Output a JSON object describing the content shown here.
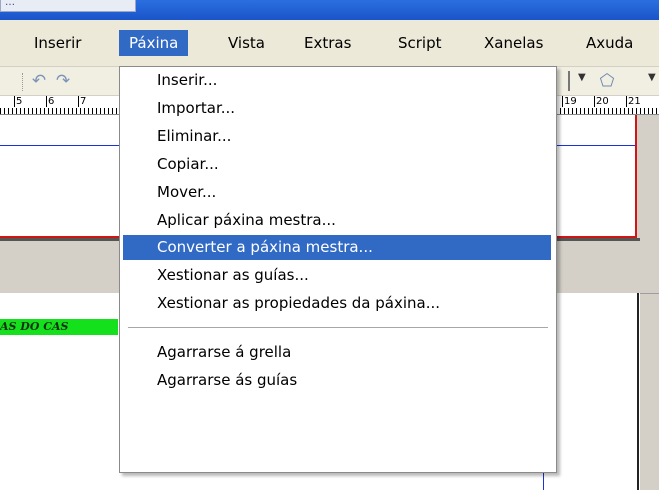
{
  "window": {
    "title_fragment": "…"
  },
  "menubar": {
    "items": [
      {
        "label": "Inserir",
        "open": false
      },
      {
        "label": "Páxina",
        "open": true
      },
      {
        "label": "Vista",
        "open": false
      },
      {
        "label": "Extras",
        "open": false
      },
      {
        "label": "Script",
        "open": false
      },
      {
        "label": "Xanelas",
        "open": false
      },
      {
        "label": "Axuda",
        "open": false
      }
    ]
  },
  "toolbar": {
    "icons": [
      "undo-icon",
      "redo-icon",
      "dropdown-arrow-icon",
      "shape-pentagon-icon",
      "dropdown-arrow-icon"
    ]
  },
  "ruler": {
    "labels_left": [
      "5",
      "6",
      "7"
    ],
    "labels_right": [
      "19",
      "20",
      "21"
    ]
  },
  "document": {
    "banner_text": "AS DO CAS"
  },
  "dropdown_menu": {
    "items": [
      {
        "label": "Inserir...",
        "highlighted": false
      },
      {
        "label": "Importar...",
        "highlighted": false
      },
      {
        "label": "Eliminar...",
        "highlighted": false
      },
      {
        "label": "Copiar...",
        "highlighted": false
      },
      {
        "label": "Mover...",
        "highlighted": false
      },
      {
        "label": "Aplicar páxina mestra...",
        "highlighted": false
      },
      {
        "label": "Converter a páxina mestra...",
        "highlighted": true
      },
      {
        "label": "Xestionar as guías...",
        "highlighted": false
      },
      {
        "label": "Xestionar as propiedades da páxina...",
        "highlighted": false
      },
      {
        "label": "Agarrarse á grella",
        "highlighted": false
      },
      {
        "label": "Agarrarse ás guías",
        "highlighted": false
      }
    ]
  },
  "colors": {
    "highlight": "#316ac5",
    "menu_bg": "#ece9d8",
    "banner_green": "#15e01c"
  }
}
